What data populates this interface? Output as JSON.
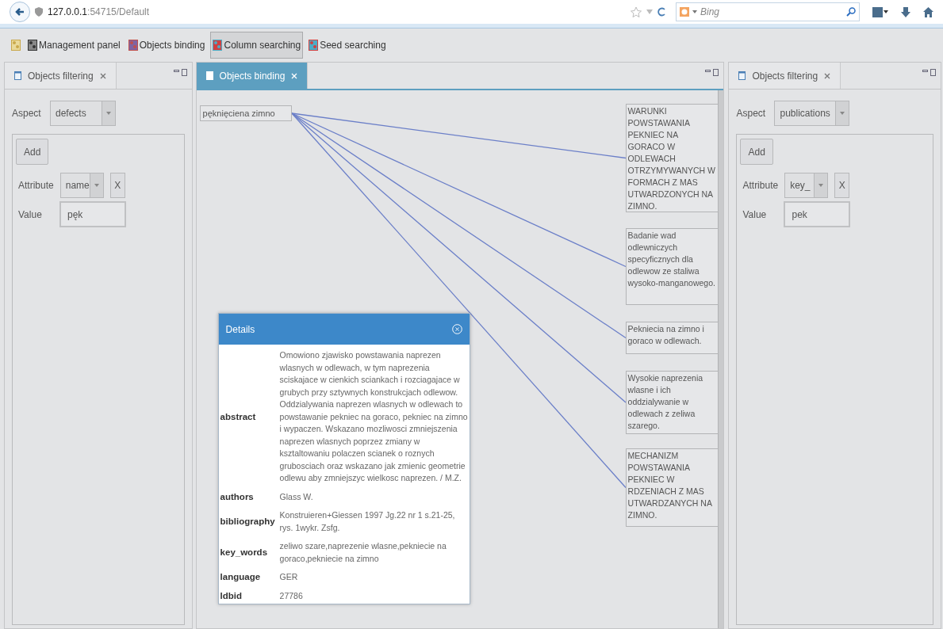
{
  "browser": {
    "address_host": "127.0.0.1",
    "address_path": ":54715/Default",
    "search_placeholder": "Bing"
  },
  "toolbar": [
    {
      "label": "Management panel",
      "selected": false
    },
    {
      "label": "Objects binding",
      "selected": false
    },
    {
      "label": "Column searching",
      "selected": true
    },
    {
      "label": "Seed searching",
      "selected": false
    }
  ],
  "left_panel": {
    "tab": {
      "label": "Objects filtering",
      "selected": false
    },
    "aspect_label": "Aspect",
    "aspect": "defects",
    "add": "Add",
    "attribute_label": "Attribute",
    "attribute": "name",
    "remove": "X",
    "value_label": "Value",
    "value": "pęk"
  },
  "binding_panel": {
    "tab": {
      "label": "Objects binding",
      "selected": true
    },
    "source": "pęknięciena zimno",
    "targets": [
      "WARUNKI POWSTAWANIA PEKNIEC NA GORACO W ODLEWACH OTRZYMYWANYCH W FORMACH Z MAS UTWARDZONYCH NA ZIMNO.",
      "Badanie wad odlewniczych specyficznych dla odlewow ze staliwa wysoko-manganowego.",
      "Pekniecia na zimno i goraco w odlewach.",
      "Wysokie naprezenia wlasne i ich oddzialywanie w odlewach z zeliwa szarego.",
      "MECHANIZM POWSTAWANIA PEKNIEC W RDZENIACH Z MAS UTWARDZANYCH NA ZIMNO."
    ]
  },
  "right_panel": {
    "tab": {
      "label": "Objects filtering",
      "selected": false
    },
    "aspect_label": "Aspect",
    "aspect": "publications",
    "add": "Add",
    "attribute_label": "Attribute",
    "attribute": "key_",
    "remove": "X",
    "value_label": "Value",
    "value": "pek"
  },
  "details": {
    "title": "Details",
    "rows": [
      {
        "key": "abstract",
        "value": "Omowiono zjawisko powstawania naprezen wlasnych w odlewach, w tym naprezenia sciskajace w cienkich sciankach i rozciagajace w grubych przy sztywnych konstrukcjach odlewow. Oddzialywania naprezen wlasnych w odlewach to powstawanie pekniec na goraco, pekniec na zimno i wypaczen. Wskazano mozliwosci zmniejszenia naprezen wlasnych poprzez zmiany w ksztaltowaniu polaczen scianek o roznych grubosciach oraz wskazano jak zmienic geometrie odlewu aby zmniejszyc wielkosc naprezen. / M.Z."
      },
      {
        "key": "authors",
        "value": "Glass W."
      },
      {
        "key": "bibliography",
        "value": "Konstruieren+Giessen 1997 Jg.22 nr 1 s.21-25, rys. 1wykr. Zsfg."
      },
      {
        "key": "key_words",
        "value": "zeliwo szare,naprezenie wlasne,pekniecie na goraco,pekniecie na zimno"
      },
      {
        "key": "language",
        "value": "GER"
      },
      {
        "key": "ldbid",
        "value": "27786"
      }
    ]
  }
}
